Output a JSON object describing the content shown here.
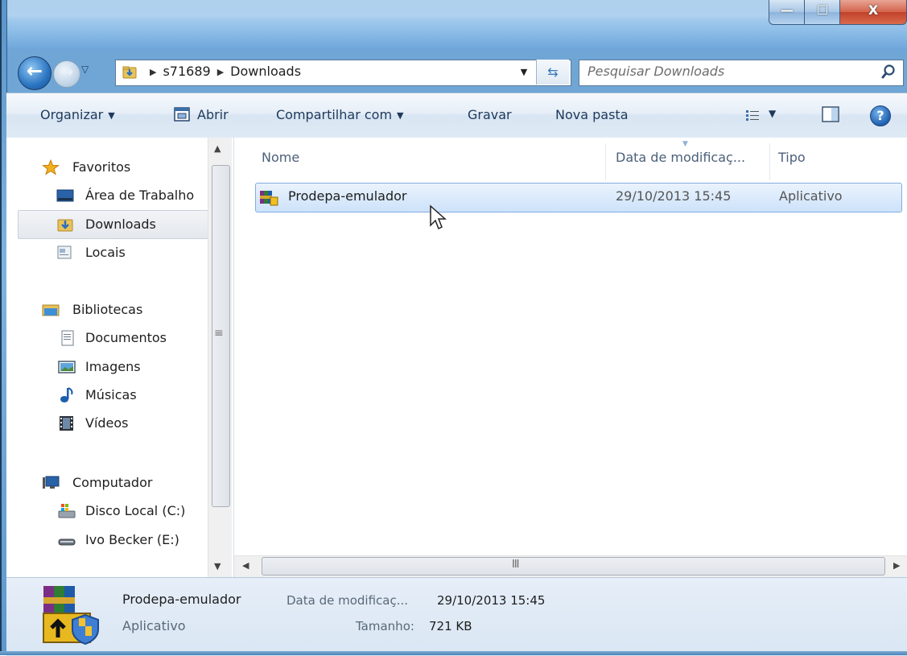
{
  "window": {
    "minimize_glyph": "—",
    "maximize_glyph": "☐",
    "close_glyph": "X"
  },
  "address": {
    "breadcrumb": [
      "s71689",
      "Downloads"
    ]
  },
  "search": {
    "placeholder": "Pesquisar Downloads"
  },
  "toolbar": {
    "organize": "Organizar",
    "open": "Abrir",
    "share": "Compartilhar com",
    "burn": "Gravar",
    "new_folder": "Nova pasta"
  },
  "nav": {
    "items": [
      {
        "label": "Favoritos",
        "icon": "star-icon"
      },
      {
        "label": "Área de Trabalho",
        "icon": "desktop-icon"
      },
      {
        "label": "Downloads",
        "icon": "downloads-folder-icon",
        "selected": true
      },
      {
        "label": "Locais",
        "icon": "recent-places-icon"
      },
      {
        "label": "Bibliotecas",
        "icon": "libraries-icon"
      },
      {
        "label": "Documentos",
        "icon": "documents-icon"
      },
      {
        "label": "Imagens",
        "icon": "pictures-icon"
      },
      {
        "label": "Músicas",
        "icon": "music-icon"
      },
      {
        "label": "Vídeos",
        "icon": "videos-icon"
      },
      {
        "label": "Computador",
        "icon": "computer-icon"
      },
      {
        "label": "Disco Local (C:)",
        "icon": "local-disk-icon"
      },
      {
        "label": "Ivo Becker (E:)",
        "icon": "removable-drive-icon"
      }
    ]
  },
  "columns": {
    "name": "Nome",
    "date": "Data de modificaç...",
    "type": "Tipo"
  },
  "files": [
    {
      "name": "Prodepa-emulador",
      "date": "29/10/2013 15:45",
      "type": "Aplicativo",
      "icon": "winrar-sfx-icon"
    }
  ],
  "details": {
    "name": "Prodepa-emulador",
    "date_label": "Data de modificaç...",
    "date_value": "29/10/2013 15:45",
    "type": "Aplicativo",
    "size_label": "Tamanho:",
    "size_value": "721 KB"
  },
  "scrollbar": {
    "grip": "III",
    "nav_grip": "≡"
  }
}
